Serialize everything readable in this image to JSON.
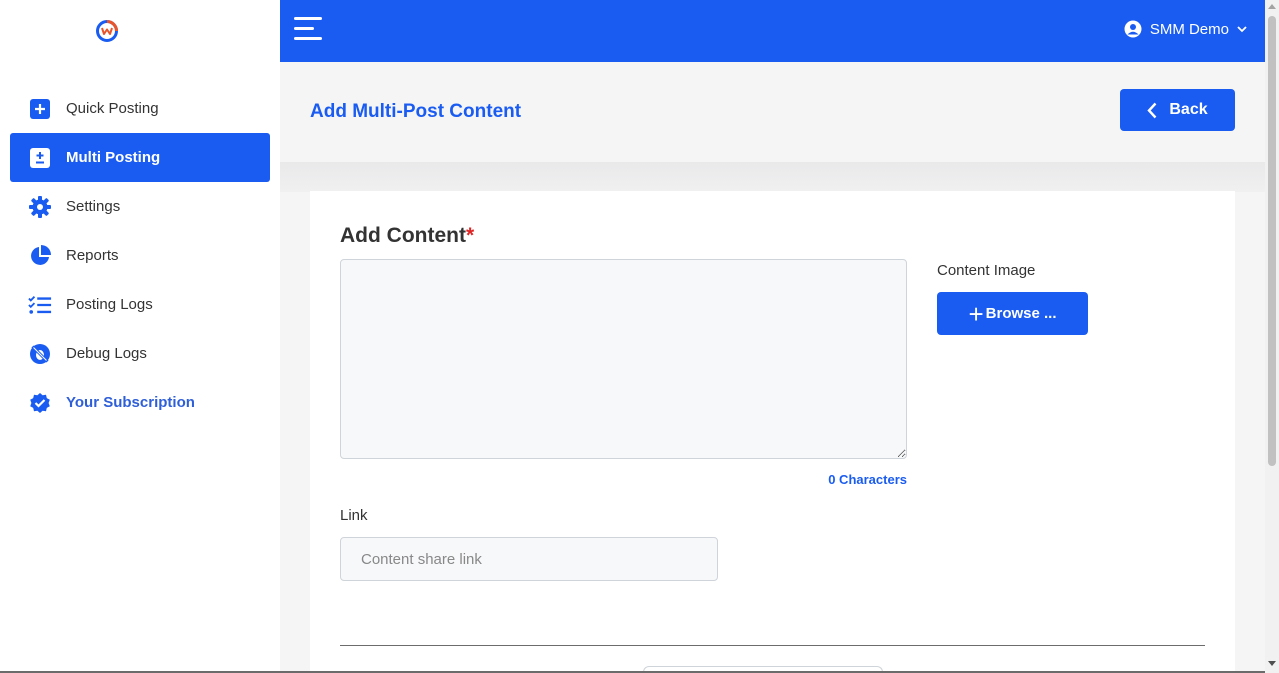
{
  "app": {
    "logo_icon": "app-logo-icon",
    "brand_colors": {
      "primary": "#1a5cf1",
      "accent": "#e8552b"
    }
  },
  "sidebar": {
    "items": [
      {
        "label": "Quick Posting",
        "icon": "plus-square-icon"
      },
      {
        "label": "Multi Posting",
        "icon": "plus-minus-square-icon",
        "active": true
      },
      {
        "label": "Settings",
        "icon": "gear-icon"
      },
      {
        "label": "Reports",
        "icon": "pie-chart-icon"
      },
      {
        "label": "Posting Logs",
        "icon": "checklist-icon"
      },
      {
        "label": "Debug Logs",
        "icon": "bug-slash-icon"
      },
      {
        "label": "Your Subscription",
        "icon": "verified-badge-icon"
      }
    ]
  },
  "topbar": {
    "menu_icon": "hamburger-menu-icon",
    "user_name": "SMM Demo",
    "user_icon": "user-circle-icon",
    "dropdown_icon": "chevron-down-icon"
  },
  "page": {
    "title": "Add Multi-Post Content",
    "back_label": "Back"
  },
  "form": {
    "content_label": "Add Content",
    "required_mark": "*",
    "content_value": "",
    "char_count": "0 Characters",
    "image_label": "Content Image",
    "browse_label": "Browse ...",
    "link_label": "Link",
    "link_value": "",
    "link_placeholder": "Content share link"
  }
}
